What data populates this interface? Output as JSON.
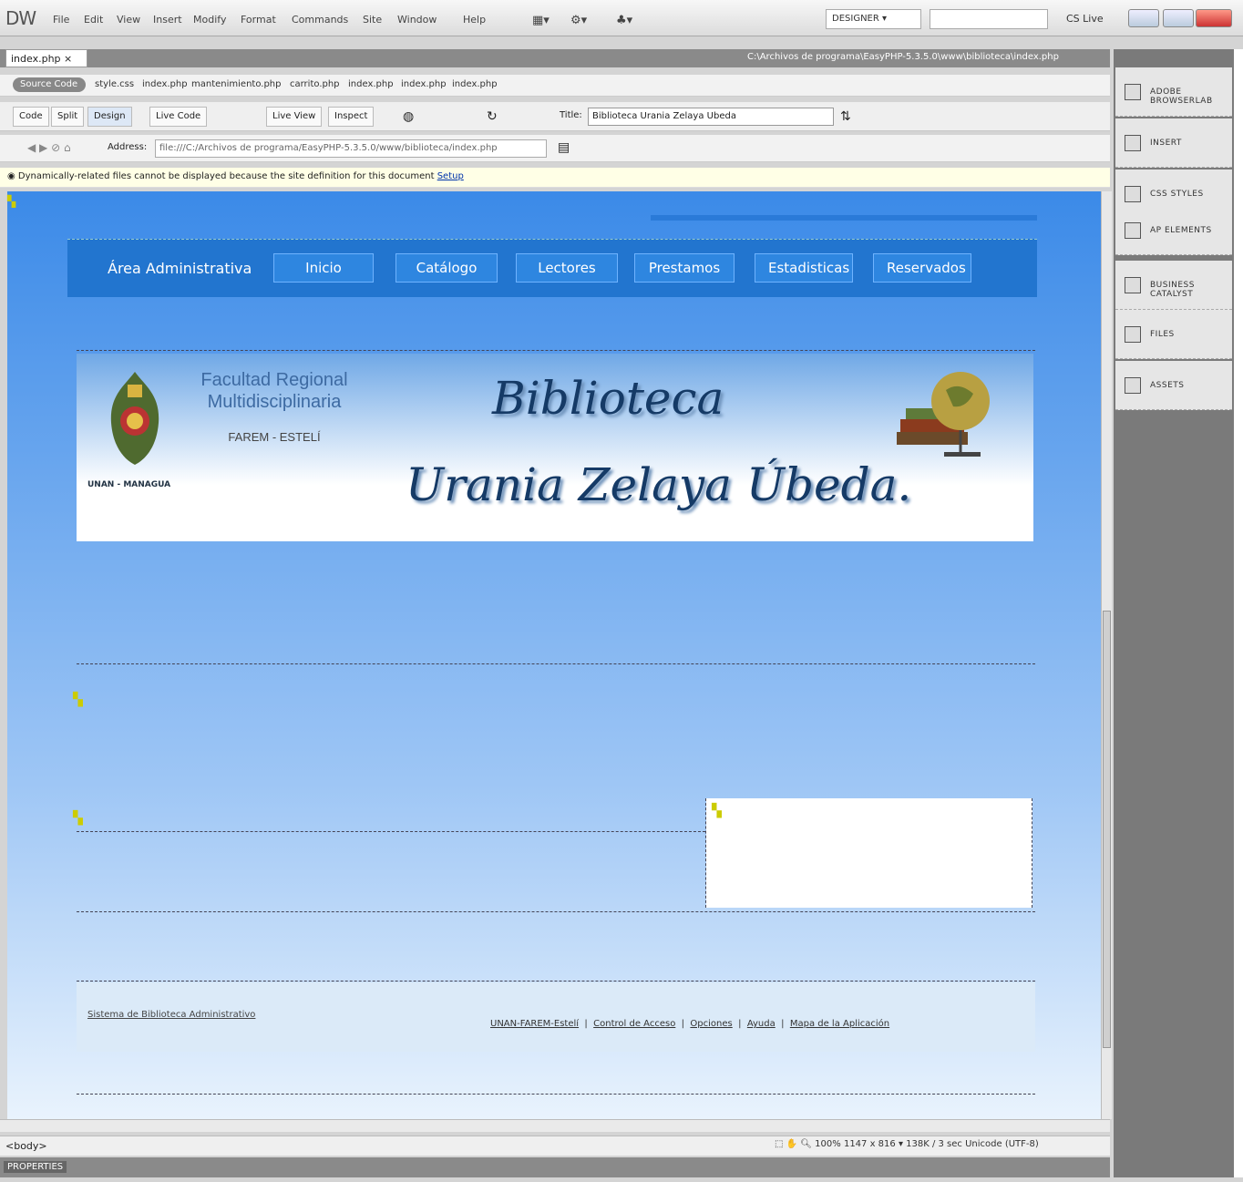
{
  "app": {
    "logo": "DW",
    "menu": [
      "File",
      "Edit",
      "View",
      "Insert",
      "Modify",
      "Format",
      "Commands",
      "Site",
      "Window",
      "Help"
    ],
    "workspace": "DESIGNER ▾",
    "cslive": "CS Live"
  },
  "doc": {
    "tab": "index.php ×",
    "path": "C:\\Archivos de programa\\EasyPHP-5.3.5.0\\www\\biblioteca\\index.php",
    "related": [
      "Source Code",
      "style.css",
      "index.php",
      "mantenimiento.php",
      "carrito.php",
      "index.php",
      "index.php",
      "index.php"
    ],
    "views": [
      "Code",
      "Split",
      "Design",
      "Live Code",
      "Live View",
      "Inspect"
    ],
    "title_label": "Title:",
    "title_value": "Biblioteca Urania Zelaya Ubeda",
    "address_label": "Address:",
    "address_value": "file:///C:/Archivos de programa/EasyPHP-5.3.5.0/www/biblioteca/index.php",
    "infobar_text": "Dynamically-related files cannot be displayed because the site definition for this document",
    "infobar_link": "Setup"
  },
  "page": {
    "nav_label": "Área Administrativa",
    "nav": [
      "Inicio",
      "Catálogo",
      "Lectores",
      "Prestamos",
      "Estadisticas",
      "Reservados"
    ],
    "fac_line1": "Facultad Regional",
    "fac_line2": "Multidisciplinaria",
    "fac_line3": "FAREM - ESTELÍ",
    "unan": "UNAN - MANAGUA",
    "bib_line1": "Biblioteca",
    "bib_line2": "Urania Zelaya Úbeda.",
    "footer_left": "Sistema de Biblioteca Administrativo",
    "footer_links": [
      "UNAN-FAREM-Estelí",
      "Control de Acceso",
      "Opciones",
      "Ayuda",
      "Mapa de la Aplicación"
    ]
  },
  "status": {
    "tag": "<body>",
    "zoom": "100%",
    "info": "1147 x 816 ▾ 138K / 3 sec Unicode (UTF-8)"
  },
  "props": {
    "label": "PROPERTIES"
  },
  "panel": [
    "ADOBE BROWSERLAB",
    "INSERT",
    "CSS STYLES",
    "AP ELEMENTS",
    "BUSINESS CATALYST",
    "FILES",
    "ASSETS"
  ],
  "colors": {
    "nav": "#2275cf",
    "page_top": "#3b8ae8",
    "title": "#153a66"
  }
}
